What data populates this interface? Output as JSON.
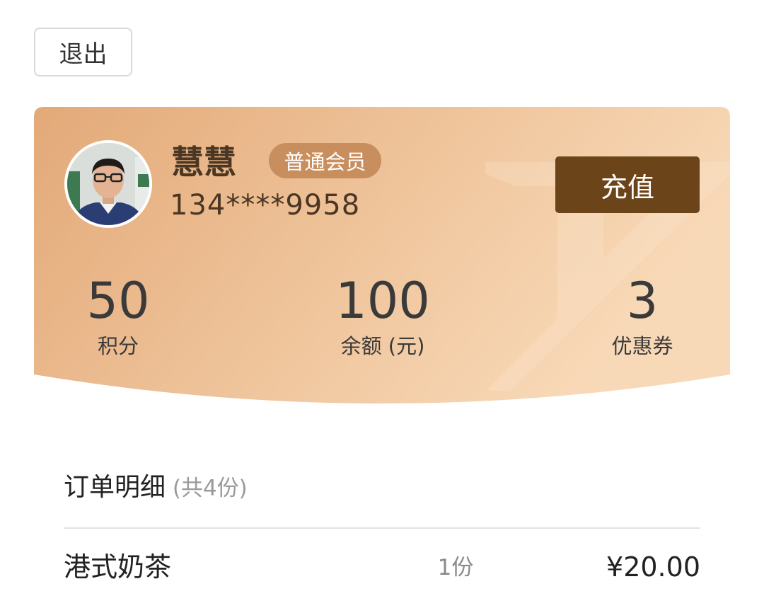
{
  "header": {
    "logout_label": "退出"
  },
  "member_card": {
    "user_name": "慧慧",
    "member_level": "普通会员",
    "phone": "134****9958",
    "recharge_label": "充值",
    "stats": [
      {
        "value": "50",
        "label": "积分"
      },
      {
        "value": "100",
        "label": "余额 (元)"
      },
      {
        "value": "3",
        "label": "优惠券"
      }
    ]
  },
  "order": {
    "title": "订单明细",
    "count": " (共4份)",
    "items": [
      {
        "name": "港式奶茶",
        "qty": "1份",
        "price": "¥20.00"
      }
    ]
  },
  "colors": {
    "card_gradient_start": "#e3a978",
    "card_gradient_end": "#f6d4af",
    "recharge_button": "#6b4419",
    "member_badge": "#c88e5d"
  }
}
